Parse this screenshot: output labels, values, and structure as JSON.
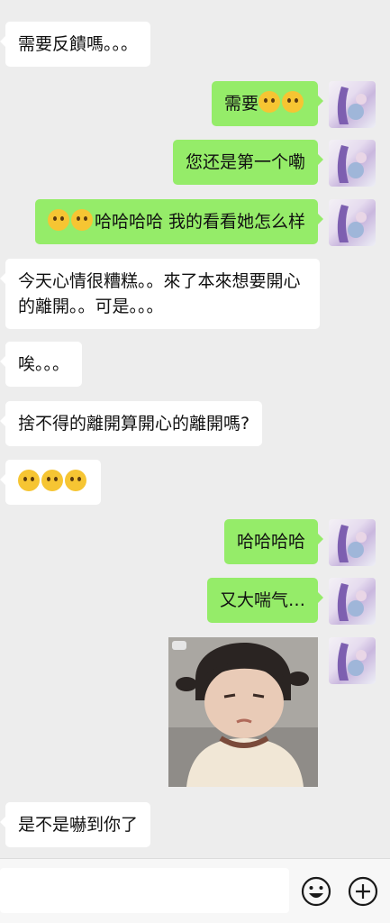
{
  "messages": [
    {
      "text": "需要反饋嗎。。。"
    },
    {
      "text": "需要"
    },
    {
      "text": "您还是第一个嘞"
    },
    {
      "text": "哈哈哈哈 我的看看她怎么样"
    },
    {
      "text": "今天心情很糟糕。。來了本來想要開心的離開。。可是。。。"
    },
    {
      "text": "唉。。。"
    },
    {
      "text": "捨不得的離開算開心的離開嗎?"
    },
    {
      "text": ""
    },
    {
      "text": "哈哈哈哈"
    },
    {
      "text": "又大喘气…"
    },
    {
      "text": "是不是嚇到你了"
    }
  ],
  "input": {
    "placeholder": ""
  },
  "icons": {
    "emoji_button": "smiley-icon",
    "plus_button": "plus-circle-icon"
  },
  "colors": {
    "background": "#ededed",
    "incoming": "#ffffff",
    "outgoing": "#95ec69"
  }
}
